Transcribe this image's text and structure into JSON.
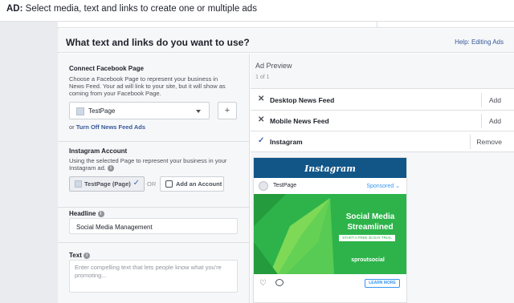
{
  "topbar": {
    "prefix": "AD:",
    "text": "Select media, text and links to create one or multiple ads"
  },
  "header": {
    "title": "What text and links do you want to use?",
    "help_link": "Help: Editing Ads"
  },
  "connect_page": {
    "title": "Connect Facebook Page",
    "description": "Choose a Facebook Page to represent your business in News Feed. Your ad will link to your site, but it will show as coming from your Facebook Page.",
    "selected_page": "TestPage",
    "add_button": "+",
    "or_text": "or",
    "turn_off_link": "Turn Off News Feed Ads"
  },
  "instagram_account": {
    "title": "Instagram Account",
    "description": "Using the selected Page to represent your business in your Instagram ad.",
    "selected_chip": "TestPage (Page)",
    "or_sep": "OR",
    "add_account": "Add an Account"
  },
  "headline": {
    "label": "Headline",
    "value": "Social Media Management"
  },
  "text_field": {
    "label": "Text",
    "placeholder": "Enter compelling text that lets people know what you're promoting..."
  },
  "ad_preview": {
    "title": "Ad Preview",
    "count": "1 of 1",
    "placements": [
      {
        "mark": "✕",
        "name": "Desktop News Feed",
        "action": "Add"
      },
      {
        "mark": "✕",
        "name": "Mobile News Feed",
        "action": "Add"
      },
      {
        "mark": "✓",
        "name": "Instagram",
        "action": "Remove"
      }
    ]
  },
  "instagram_preview": {
    "logo": "Instagram",
    "username": "TestPage",
    "sponsored": "Sponsored",
    "headline": "Social Media Streamlined",
    "cta_small": "START A FREE 30 DAY TRIAL",
    "brand": "sproutsocial",
    "learn_more": "LEARN MORE"
  },
  "colors": {
    "link": "#365899",
    "instagram_header": "#125688",
    "sprout_green": "#2db34a"
  }
}
